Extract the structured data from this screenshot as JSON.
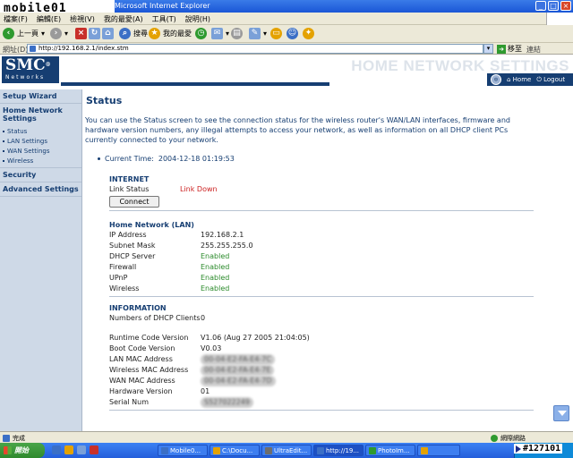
{
  "browser": {
    "window_title": "Microsoft Internet Explorer",
    "watermark": "mobile01",
    "menu": [
      "檔案(F)",
      "編輯(E)",
      "檢視(V)",
      "我的最愛(A)",
      "工具(T)",
      "說明(H)"
    ],
    "toolbar": {
      "back_label": "上一頁",
      "search_label": "搜尋",
      "favorites_label": "我的最愛"
    },
    "address": {
      "label": "網址(D)",
      "url": "http://192.168.2.1/index.stm",
      "go_label": "移至",
      "links_label": "連結"
    },
    "status": {
      "left": "完成",
      "right": "網際網路"
    }
  },
  "header": {
    "logo": "SMC",
    "logo_sub": "Networks",
    "logo_reg": "®",
    "banner": "HOME NETWORK SETTINGS",
    "nav_home": "Home",
    "nav_logout": "Logout"
  },
  "sidebar": {
    "setup_wizard": "Setup Wizard",
    "home_network_settings": "Home Network Settings",
    "subitems": [
      "Status",
      "LAN Settings",
      "WAN Settings",
      "Wireless"
    ],
    "security": "Security",
    "advanced": "Advanced Settings"
  },
  "main": {
    "title": "Status",
    "intro": "You can use the Status screen to see the connection status for the wireless router's WAN/LAN interfaces, firmware and hardware version numbers, any illegal attempts to access your network, as well as information on all DHCP client PCs currently connected to your network.",
    "current_time_label": "Current Time:",
    "current_time": "2004-12-18 01:19:53",
    "internet": {
      "heading": "INTERNET",
      "link_status_label": "Link Status",
      "link_status": "Link Down",
      "connect_label": "Connect"
    },
    "lan": {
      "heading": "Home Network (LAN)",
      "rows": [
        {
          "k": "IP Address",
          "v": "192.168.2.1"
        },
        {
          "k": "Subnet Mask",
          "v": "255.255.255.0"
        },
        {
          "k": "DHCP Server",
          "v": "Enabled"
        },
        {
          "k": "Firewall",
          "v": "Enabled"
        },
        {
          "k": "UPnP",
          "v": "Enabled"
        },
        {
          "k": "Wireless",
          "v": "Enabled"
        }
      ]
    },
    "information": {
      "heading": "INFORMATION",
      "dhcp_label": "Numbers of DHCP Clients",
      "dhcp_value": "0",
      "runtime_label": "Runtime Code Version",
      "runtime_value": "V1.06 (Aug 27 2005 21:04:05)",
      "boot_label": "Boot Code Version",
      "boot_value": "V0.03",
      "lan_mac_label": "LAN MAC Address",
      "lan_mac_value": "00-04-E2-FA-E4-7C",
      "wl_mac_label": "Wireless MAC Address",
      "wl_mac_value": "00-04-E2-FA-E4-7E",
      "wan_mac_label": "WAN MAC Address",
      "wan_mac_value": "00-04-E2-FA-E4-7D",
      "hw_label": "Hardware Version",
      "hw_value": "01",
      "serial_label": "Serial Num",
      "serial_value": "S527022249"
    }
  },
  "taskbar": {
    "start": "開始",
    "tasks": [
      "Mobile0...",
      "C:\\Docu...",
      "UltraEdit...",
      "http://19...",
      "PhotoIm...",
      ""
    ],
    "stamp": "#127101"
  }
}
